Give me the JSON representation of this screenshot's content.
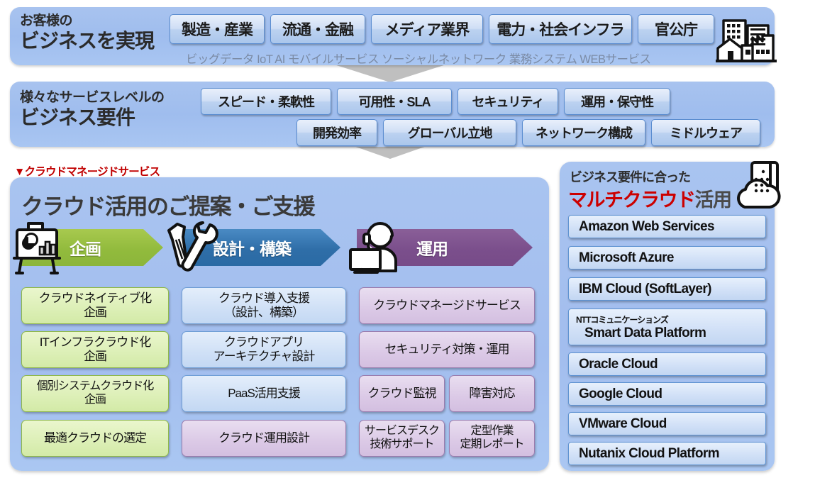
{
  "band1": {
    "title_small": "お客様の",
    "title_big": "ビジネスを実現",
    "chips": [
      "製造・産業",
      "流通・金融",
      "メディア業界",
      "電力・社会インフラ",
      "官公庁"
    ],
    "keywords": "ビッグデータ  IoT  AI  モバイルサービス  ソーシャルネットワーク  業務システム  WEBサービス",
    "icon": "buildings-icon"
  },
  "band2": {
    "title_small": "様々なサービスレベルの",
    "title_big": "ビジネス要件",
    "chips_row1": [
      "スピード・柔軟性",
      "可用性・SLA",
      "セキュリティ",
      "運用・保守性"
    ],
    "chips_row2": [
      "開発効率",
      "グローバル立地",
      "ネットワーク構成",
      "ミドルウェア"
    ]
  },
  "main": {
    "red_heading": "▼クラウドマネージドサービス",
    "heading": "クラウド活用のご提案・ご支援",
    "phases": [
      {
        "label": "企画",
        "color": "#92bb3d",
        "icon": "presentation-board-icon"
      },
      {
        "label": "設計・構築",
        "color": "#2f6ea8",
        "icon": "tools-icon"
      },
      {
        "label": "運用",
        "color": "#7b4f8c",
        "icon": "operator-headset-icon"
      }
    ],
    "col1": [
      "クラウドネイティブ化\n企画",
      "ITインフラクラウド化\n企画",
      "個別システムクラウド化\n企画",
      "最適クラウドの選定"
    ],
    "col2": [
      "クラウド導入支援\n（設計、構築）",
      "クラウドアプリ\nアーキテクチャ設計",
      "PaaS活用支援",
      "クラウド運用設計"
    ],
    "col3_wide": [
      "クラウドマネージドサービス",
      "セキュリティ対策・運用"
    ],
    "col3_pairs": [
      [
        "クラウド監視",
        "障害対応"
      ],
      [
        "サービスデスク\n技術サポート",
        "定型作業\n定期レポート"
      ]
    ]
  },
  "sidebar": {
    "subtitle": "ビジネス要件に合った",
    "title_red": "マルチクラウド",
    "title_gray": "活用",
    "icon": "cloud-server-icon",
    "vendors": [
      {
        "name": "Amazon Web Services"
      },
      {
        "name": "Microsoft Azure"
      },
      {
        "name": "IBM Cloud (SoftLayer)"
      },
      {
        "caption": "NTTコミュニケーションズ",
        "name": "Smart Data Platform"
      },
      {
        "name": "Oracle Cloud"
      },
      {
        "name": "Google Cloud"
      },
      {
        "name": "VMware Cloud"
      },
      {
        "name": "Nutanix Cloud Platform"
      }
    ]
  },
  "colors": {
    "band_blue": "#a6c1ef",
    "chip_blue": "#cfdef5",
    "red_accent": "#c00000",
    "green": "#92bb3d",
    "blue": "#2f6ea8",
    "purple": "#7b4f8c",
    "chevron_gray": "#bfbfbf"
  }
}
